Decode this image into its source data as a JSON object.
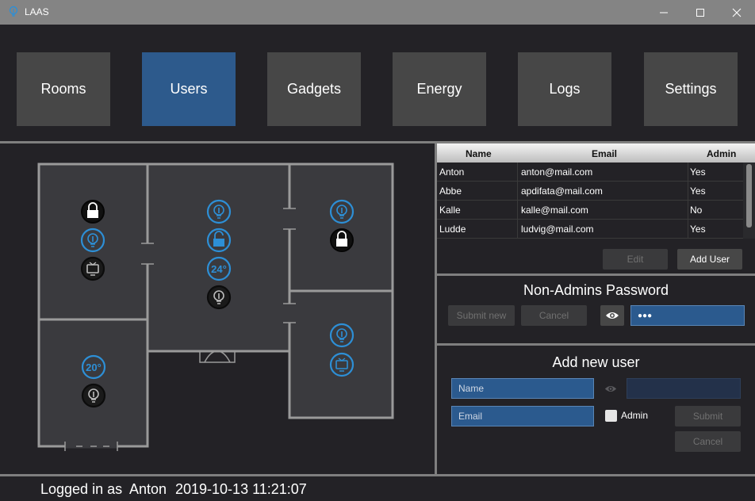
{
  "window": {
    "title": "LAAS"
  },
  "nav": {
    "items": [
      {
        "label": "Rooms"
      },
      {
        "label": "Users"
      },
      {
        "label": "Gadgets"
      },
      {
        "label": "Energy"
      },
      {
        "label": "Logs"
      },
      {
        "label": "Settings"
      }
    ],
    "active": "Users"
  },
  "floorplan": {
    "room_temps": [
      "24°",
      "20°"
    ],
    "icons": [
      "lock-icon",
      "lightbulb-icon",
      "tv-icon",
      "thermostat-icon"
    ]
  },
  "users_table": {
    "columns": [
      "Name",
      "Email",
      "Admin"
    ],
    "rows": [
      {
        "name": "Anton",
        "email": "anton@mail.com",
        "admin": "Yes"
      },
      {
        "name": "Abbe",
        "email": "apdifata@mail.com",
        "admin": "Yes"
      },
      {
        "name": "Kalle",
        "email": "kalle@mail.com",
        "admin": "No"
      },
      {
        "name": "Ludde",
        "email": "ludvig@mail.com",
        "admin": "Yes"
      }
    ],
    "edit_label": "Edit",
    "add_user_label": "Add User"
  },
  "non_admin_password": {
    "title": "Non-Admins Password",
    "submit_label": "Submit new",
    "cancel_label": "Cancel",
    "password_mask": "●●●"
  },
  "add_user": {
    "title": "Add new user",
    "name_placeholder": "Name",
    "email_placeholder": "Email",
    "admin_label": "Admin",
    "submit_label": "Submit",
    "cancel_label": "Cancel"
  },
  "status": {
    "logged_in_prefix": "Logged in as",
    "user": "Anton",
    "datetime": "2019-10-13 11:21:07"
  },
  "colors": {
    "accent": "#2d5a8c",
    "icon_blue": "#2d8fd6",
    "background": "#232226",
    "button": "#474747"
  }
}
